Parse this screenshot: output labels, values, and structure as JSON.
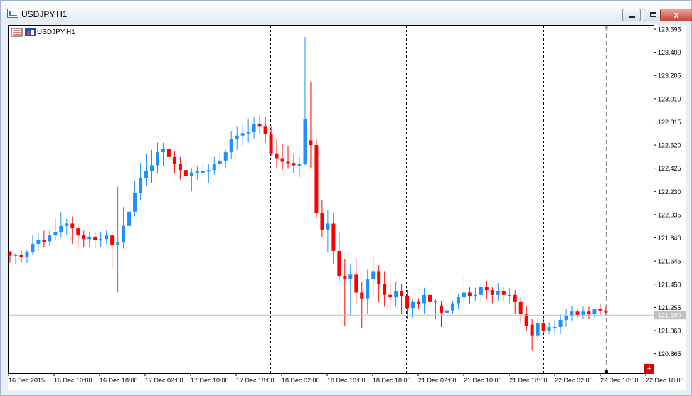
{
  "window": {
    "title": "USDJPY,H1",
    "close_label": "x"
  },
  "chart_label": "USDJPY,H1",
  "chart_close_label": "+",
  "colors": {
    "bull": "#1e90ff",
    "bear": "#ff0000",
    "grid": "#000000",
    "background": "#ffffff",
    "price_line": "#c0c0c0"
  },
  "chart_data": {
    "type": "candlestick",
    "symbol": "USDJPY",
    "timeframe": "H1",
    "ylim": [
      120.75,
      123.65
    ],
    "y_ticks": [
      "123.595",
      "123.400",
      "123.205",
      "123.010",
      "122.815",
      "122.620",
      "122.425",
      "122.230",
      "122.035",
      "121.840",
      "121.645",
      "121.450",
      "121.255",
      "121.060",
      "120.865"
    ],
    "x_ticks": [
      "16 Dec 2015",
      "16 Dec 10:00",
      "16 Dec 18:00",
      "17 Dec 02:00",
      "17 Dec 10:00",
      "17 Dec 18:00",
      "18 Dec 02:00",
      "18 Dec 10:00",
      "18 Dec 18:00",
      "21 Dec 02:00",
      "21 Dec 10:00",
      "21 Dec 18:00",
      "22 Dec 02:00",
      "22 Dec 10:00",
      "22 Dec 18:00"
    ],
    "current_price": "121.190",
    "candles": [
      [
        121.72,
        121.73,
        121.63,
        121.69
      ],
      [
        121.69,
        121.71,
        121.62,
        121.7
      ],
      [
        121.7,
        121.73,
        121.63,
        121.68
      ],
      [
        121.68,
        121.74,
        121.63,
        121.72
      ],
      [
        121.72,
        121.86,
        121.7,
        121.79
      ],
      [
        121.79,
        121.88,
        121.73,
        121.82
      ],
      [
        121.82,
        121.9,
        121.76,
        121.81
      ],
      [
        121.81,
        121.9,
        121.77,
        121.86
      ],
      [
        121.86,
        122.0,
        121.82,
        121.89
      ],
      [
        121.89,
        122.06,
        121.84,
        121.94
      ],
      [
        121.94,
        122.0,
        121.86,
        121.96
      ],
      [
        121.96,
        122.02,
        121.79,
        121.92
      ],
      [
        121.92,
        121.96,
        121.75,
        121.86
      ],
      [
        121.86,
        121.9,
        121.76,
        121.83
      ],
      [
        121.83,
        121.89,
        121.76,
        121.85
      ],
      [
        121.85,
        121.89,
        121.75,
        121.82
      ],
      [
        121.82,
        121.89,
        121.76,
        121.83
      ],
      [
        121.83,
        121.9,
        121.79,
        121.86
      ],
      [
        121.86,
        121.89,
        121.58,
        121.78
      ],
      [
        121.78,
        122.27,
        121.38,
        121.8
      ],
      [
        121.8,
        122.1,
        121.75,
        121.94
      ],
      [
        121.94,
        122.2,
        121.85,
        122.06
      ],
      [
        122.06,
        122.32,
        122.02,
        122.22
      ],
      [
        122.22,
        122.47,
        122.16,
        122.34
      ],
      [
        122.34,
        122.55,
        122.28,
        122.4
      ],
      [
        122.4,
        122.58,
        122.3,
        122.45
      ],
      [
        122.45,
        122.64,
        122.38,
        122.56
      ],
      [
        122.56,
        122.64,
        122.44,
        122.59
      ],
      [
        122.59,
        122.64,
        122.46,
        122.52
      ],
      [
        122.52,
        122.57,
        122.38,
        122.46
      ],
      [
        122.46,
        122.52,
        122.33,
        122.41
      ],
      [
        122.41,
        122.48,
        122.31,
        122.36
      ],
      [
        122.36,
        122.42,
        122.23,
        122.39
      ],
      [
        122.39,
        122.44,
        122.33,
        122.4
      ],
      [
        122.4,
        122.46,
        122.35,
        122.4
      ],
      [
        122.4,
        122.46,
        122.3,
        122.41
      ],
      [
        122.41,
        122.52,
        122.37,
        122.46
      ],
      [
        122.46,
        122.56,
        122.4,
        122.49
      ],
      [
        122.49,
        122.58,
        122.43,
        122.56
      ],
      [
        122.56,
        122.74,
        122.5,
        122.67
      ],
      [
        122.67,
        122.78,
        122.58,
        122.7
      ],
      [
        122.7,
        122.8,
        122.61,
        122.72
      ],
      [
        122.72,
        122.84,
        122.64,
        122.73
      ],
      [
        122.73,
        122.86,
        122.67,
        122.8
      ],
      [
        122.8,
        122.87,
        122.71,
        122.78
      ],
      [
        122.78,
        122.86,
        122.64,
        122.71
      ],
      [
        122.71,
        122.78,
        122.53,
        122.55
      ],
      [
        122.55,
        122.67,
        122.43,
        122.51
      ],
      [
        122.51,
        122.63,
        122.41,
        122.48
      ],
      [
        122.48,
        122.61,
        122.42,
        122.47
      ],
      [
        122.47,
        122.55,
        122.38,
        122.45
      ],
      [
        122.45,
        122.52,
        122.35,
        122.46
      ],
      [
        122.46,
        123.53,
        122.45,
        122.84
      ],
      [
        122.66,
        123.15,
        122.43,
        122.62
      ],
      [
        122.62,
        122.67,
        122.01,
        122.05
      ],
      [
        122.05,
        122.16,
        121.85,
        121.91
      ],
      [
        121.91,
        122.07,
        121.72,
        121.96
      ],
      [
        121.96,
        122.05,
        121.62,
        121.73
      ],
      [
        121.73,
        121.89,
        121.48,
        121.52
      ],
      [
        121.52,
        121.66,
        121.1,
        121.49
      ],
      [
        121.49,
        121.62,
        121.18,
        121.53
      ],
      [
        121.53,
        121.66,
        121.29,
        121.38
      ],
      [
        121.38,
        121.47,
        121.08,
        121.33
      ],
      [
        121.33,
        121.57,
        121.2,
        121.49
      ],
      [
        121.49,
        121.69,
        121.35,
        121.56
      ],
      [
        121.56,
        121.61,
        121.3,
        121.45
      ],
      [
        121.45,
        121.56,
        121.26,
        121.36
      ],
      [
        121.36,
        121.46,
        121.22,
        121.34
      ],
      [
        121.34,
        121.47,
        121.26,
        121.39
      ],
      [
        121.39,
        121.45,
        121.2,
        121.35
      ],
      [
        121.35,
        121.4,
        121.16,
        121.25
      ],
      [
        121.25,
        121.32,
        121.17,
        121.3
      ],
      [
        121.3,
        121.33,
        121.24,
        121.29
      ],
      [
        121.29,
        121.42,
        121.2,
        121.36
      ],
      [
        121.36,
        121.41,
        121.23,
        121.3
      ],
      [
        121.3,
        121.33,
        121.16,
        121.31
      ],
      [
        121.27,
        121.31,
        121.09,
        121.21
      ],
      [
        121.21,
        121.29,
        121.16,
        121.23
      ],
      [
        121.23,
        121.31,
        121.2,
        121.29
      ],
      [
        121.29,
        121.37,
        121.24,
        121.34
      ],
      [
        121.34,
        121.51,
        121.28,
        121.38
      ],
      [
        121.38,
        121.43,
        121.29,
        121.35
      ],
      [
        121.35,
        121.42,
        121.31,
        121.36
      ],
      [
        121.36,
        121.46,
        121.3,
        121.43
      ],
      [
        121.43,
        121.48,
        121.33,
        121.4
      ],
      [
        121.4,
        121.43,
        121.29,
        121.36
      ],
      [
        121.36,
        121.46,
        121.31,
        121.39
      ],
      [
        121.39,
        121.43,
        121.31,
        121.36
      ],
      [
        121.36,
        121.42,
        121.29,
        121.36
      ],
      [
        121.36,
        121.4,
        121.2,
        121.3
      ],
      [
        121.3,
        121.34,
        121.12,
        121.2
      ],
      [
        121.2,
        121.27,
        121.06,
        121.1
      ],
      [
        121.11,
        121.16,
        120.89,
        121.02
      ],
      [
        121.02,
        121.16,
        120.98,
        121.12
      ],
      [
        121.12,
        121.17,
        121.04,
        121.06
      ],
      [
        121.06,
        121.13,
        121.03,
        121.09
      ],
      [
        121.09,
        121.15,
        121.04,
        121.09
      ],
      [
        121.09,
        121.2,
        121.03,
        121.15
      ],
      [
        121.15,
        121.24,
        121.09,
        121.18
      ],
      [
        121.18,
        121.27,
        121.14,
        121.22
      ],
      [
        121.22,
        121.24,
        121.17,
        121.19
      ],
      [
        121.19,
        121.26,
        121.16,
        121.22
      ],
      [
        121.22,
        121.26,
        121.16,
        121.2
      ],
      [
        121.2,
        121.24,
        121.17,
        121.24
      ],
      [
        121.24,
        121.28,
        121.19,
        121.23
      ],
      [
        121.23,
        121.27,
        121.18,
        121.21
      ]
    ]
  }
}
